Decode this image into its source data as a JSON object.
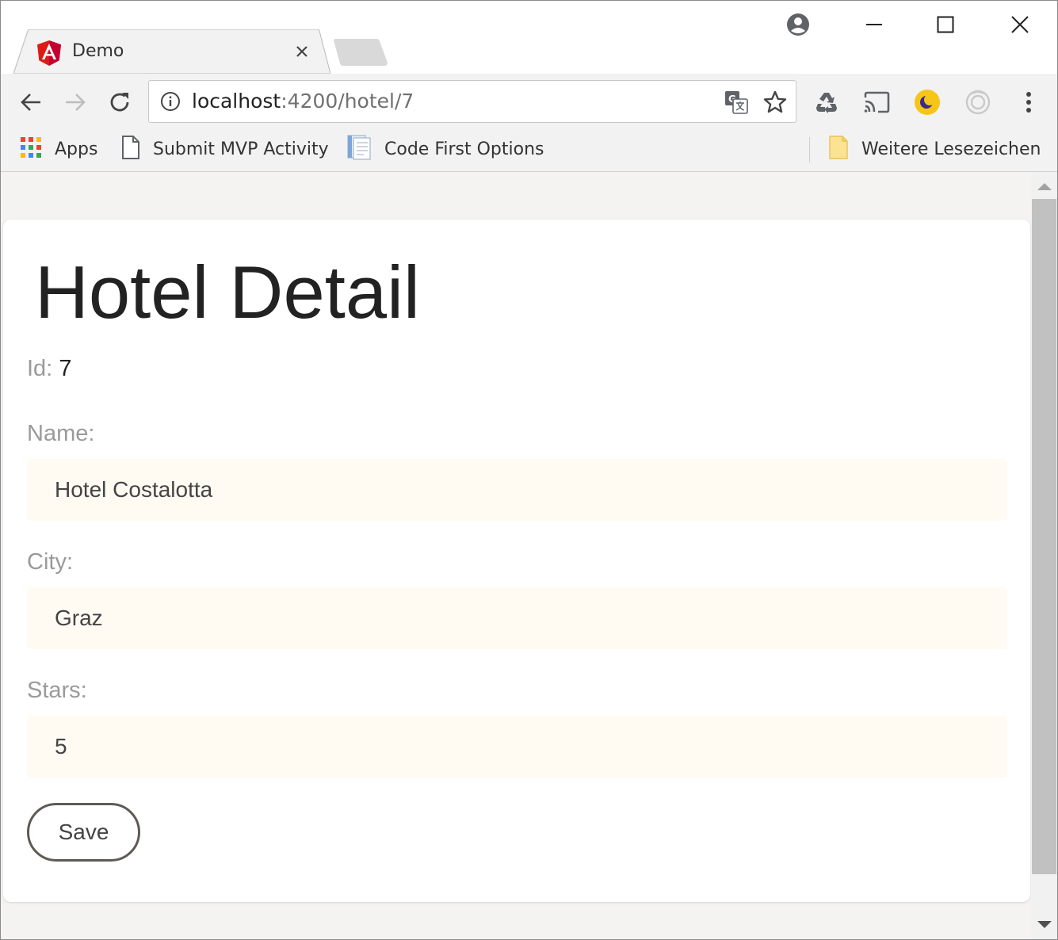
{
  "browser": {
    "tab": {
      "title": "Demo",
      "favicon": "angular-logo-icon"
    },
    "address": {
      "host": "localhost",
      "rest": ":4200/hotel/7"
    },
    "bookmarks": [
      {
        "label": "Apps",
        "icon": "apps-grid-icon"
      },
      {
        "label": "Submit MVP Activity",
        "icon": "page-icon"
      },
      {
        "label": "Code First Options",
        "icon": "document-icon"
      },
      {
        "label": "Weitere Lesezeichen",
        "icon": "folder-icon"
      }
    ],
    "extensions": [
      "recycle-icon",
      "cast-icon",
      "night-mode-icon",
      "record-icon"
    ],
    "colors": {
      "angular_red": "#dd1b16",
      "night_mode_yellow": "#f5c518"
    }
  },
  "page": {
    "title": "Hotel Detail",
    "id_label": "Id:",
    "id_value": "7",
    "fields": {
      "name": {
        "label": "Name:",
        "value": "Hotel Costalotta"
      },
      "city": {
        "label": "City:",
        "value": "Graz"
      },
      "stars": {
        "label": "Stars:",
        "value": "5"
      }
    },
    "save_label": "Save"
  }
}
